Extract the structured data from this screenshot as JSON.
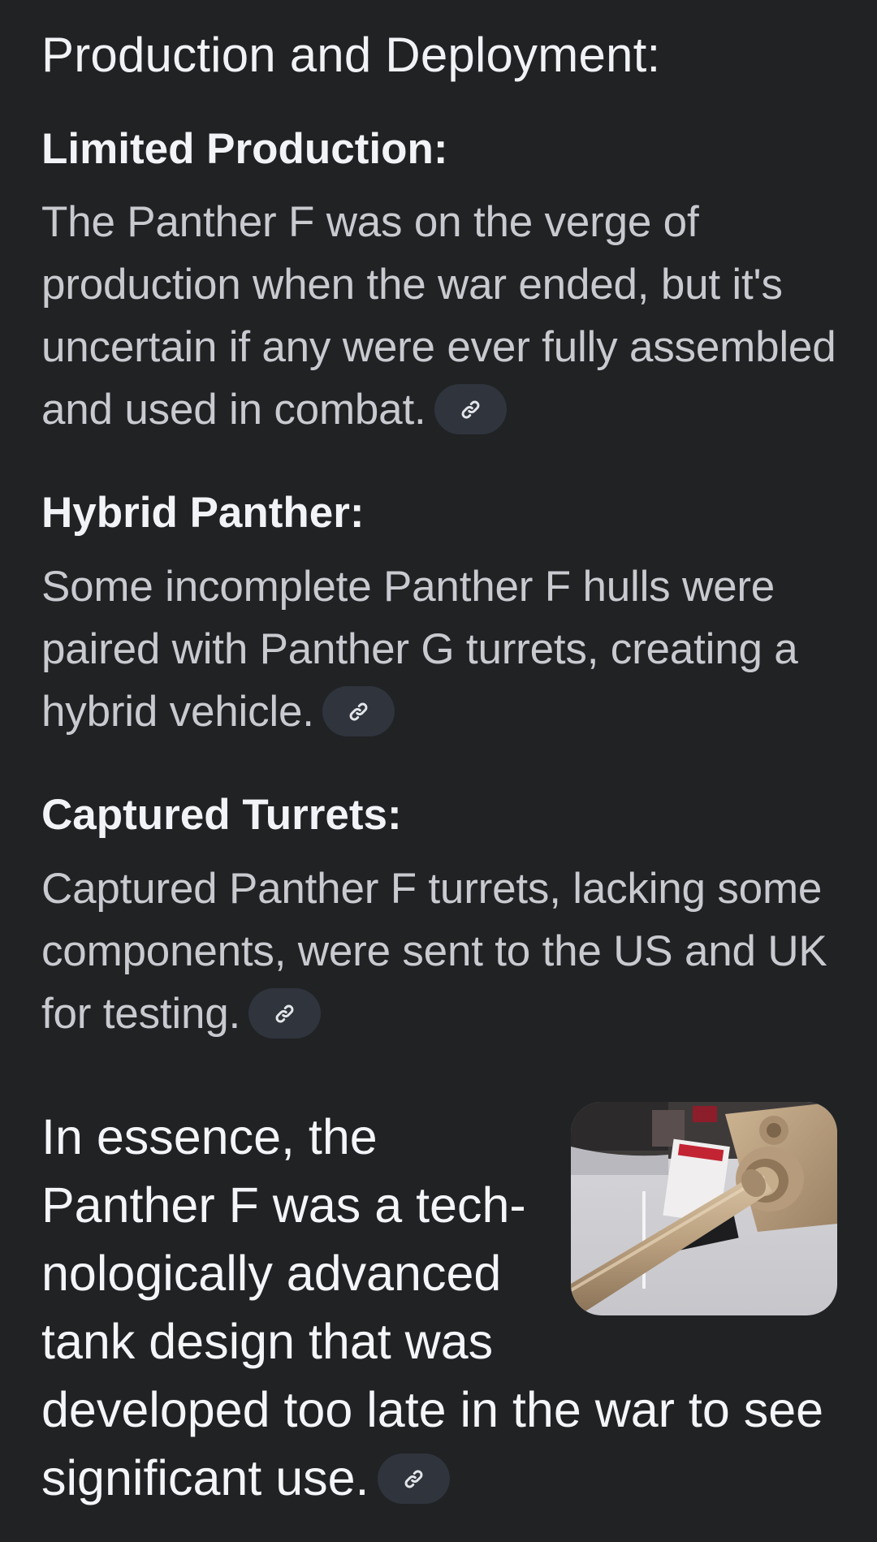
{
  "section_title": "Production and Deployment:",
  "sections": [
    {
      "heading": "Limited Production:",
      "body": "The Panther F was on the verge of production when the war ended, but it's uncertain if any were ever fully assembled and used in combat."
    },
    {
      "heading": "Hybrid Panther:",
      "body": "Some incomplete Panther F hulls were paired with Panther G turrets, creating a hybrid vehicle."
    },
    {
      "heading": "Captured Turrets:",
      "body": "Captured Panther F turrets, lacking some components, were sent to the US and UK for testing."
    }
  ],
  "summary": {
    "text": "In essence, the Panther F was a tech­nologically advanced tank design that was developed too late in the war to see significant use."
  },
  "icons": {
    "source_link": "link-icon"
  },
  "colors": {
    "background": "#202224",
    "chip": "#2f343d",
    "heading_text": "#f2f3f6",
    "body_text": "#c9cad0"
  }
}
